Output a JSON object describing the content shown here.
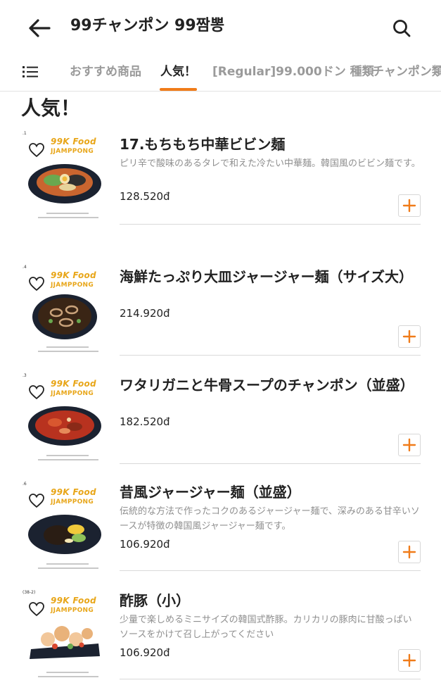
{
  "header": {
    "title": "99チャンポン 99짬뽕",
    "back_icon": "arrow-left-icon",
    "search_icon": "search-icon"
  },
  "tabs": {
    "menu_icon": "list-menu-icon",
    "items": [
      {
        "label": "おすすめ商品",
        "active": false
      },
      {
        "label": "人気！",
        "active": true
      },
      {
        "label": "[Regular]99.000ドン 種類",
        "active": false
      },
      {
        "label": "チャンポン類",
        "active": false
      }
    ]
  },
  "section": {
    "title": "人気！"
  },
  "brand": {
    "line1": "99K Food",
    "line2": "JJAMPPONG"
  },
  "colors": {
    "accent": "#f07c1a",
    "brand_yellow": "#e8a619"
  },
  "items": [
    {
      "name": "17.もちもち中華ビビン麺",
      "description": "ピリ辛で酸味のあるタレで和えた冷たい中華麺。韓国風のビビン麺です。",
      "price": "128.520đ",
      "corner_mark": ".1"
    },
    {
      "name": "海鮮たっぷり大皿ジャージャー麺（サイズ大）",
      "description": "",
      "price": "214.920đ",
      "corner_mark": ".4"
    },
    {
      "name": "ワタリガニと牛骨スープのチャンポン（並盛）",
      "description": "",
      "price": "182.520đ",
      "corner_mark": ".3"
    },
    {
      "name": "昔風ジャージャー麺（並盛）",
      "description": "伝統的な方法で作ったコクのあるジャージャー麺で、深みのある甘辛いソースが特徴の韓国風ジャージャー麺です。",
      "price": "106.920đ",
      "corner_mark": ".6"
    },
    {
      "name": "酢豚（小）",
      "description": "少量で楽しめるミニサイズの韓国式酢豚。カリカリの豚肉に甘酸っぱいソースをかけて召し上がってください",
      "price": "106.920đ",
      "corner_mark": "(38-2)"
    }
  ]
}
